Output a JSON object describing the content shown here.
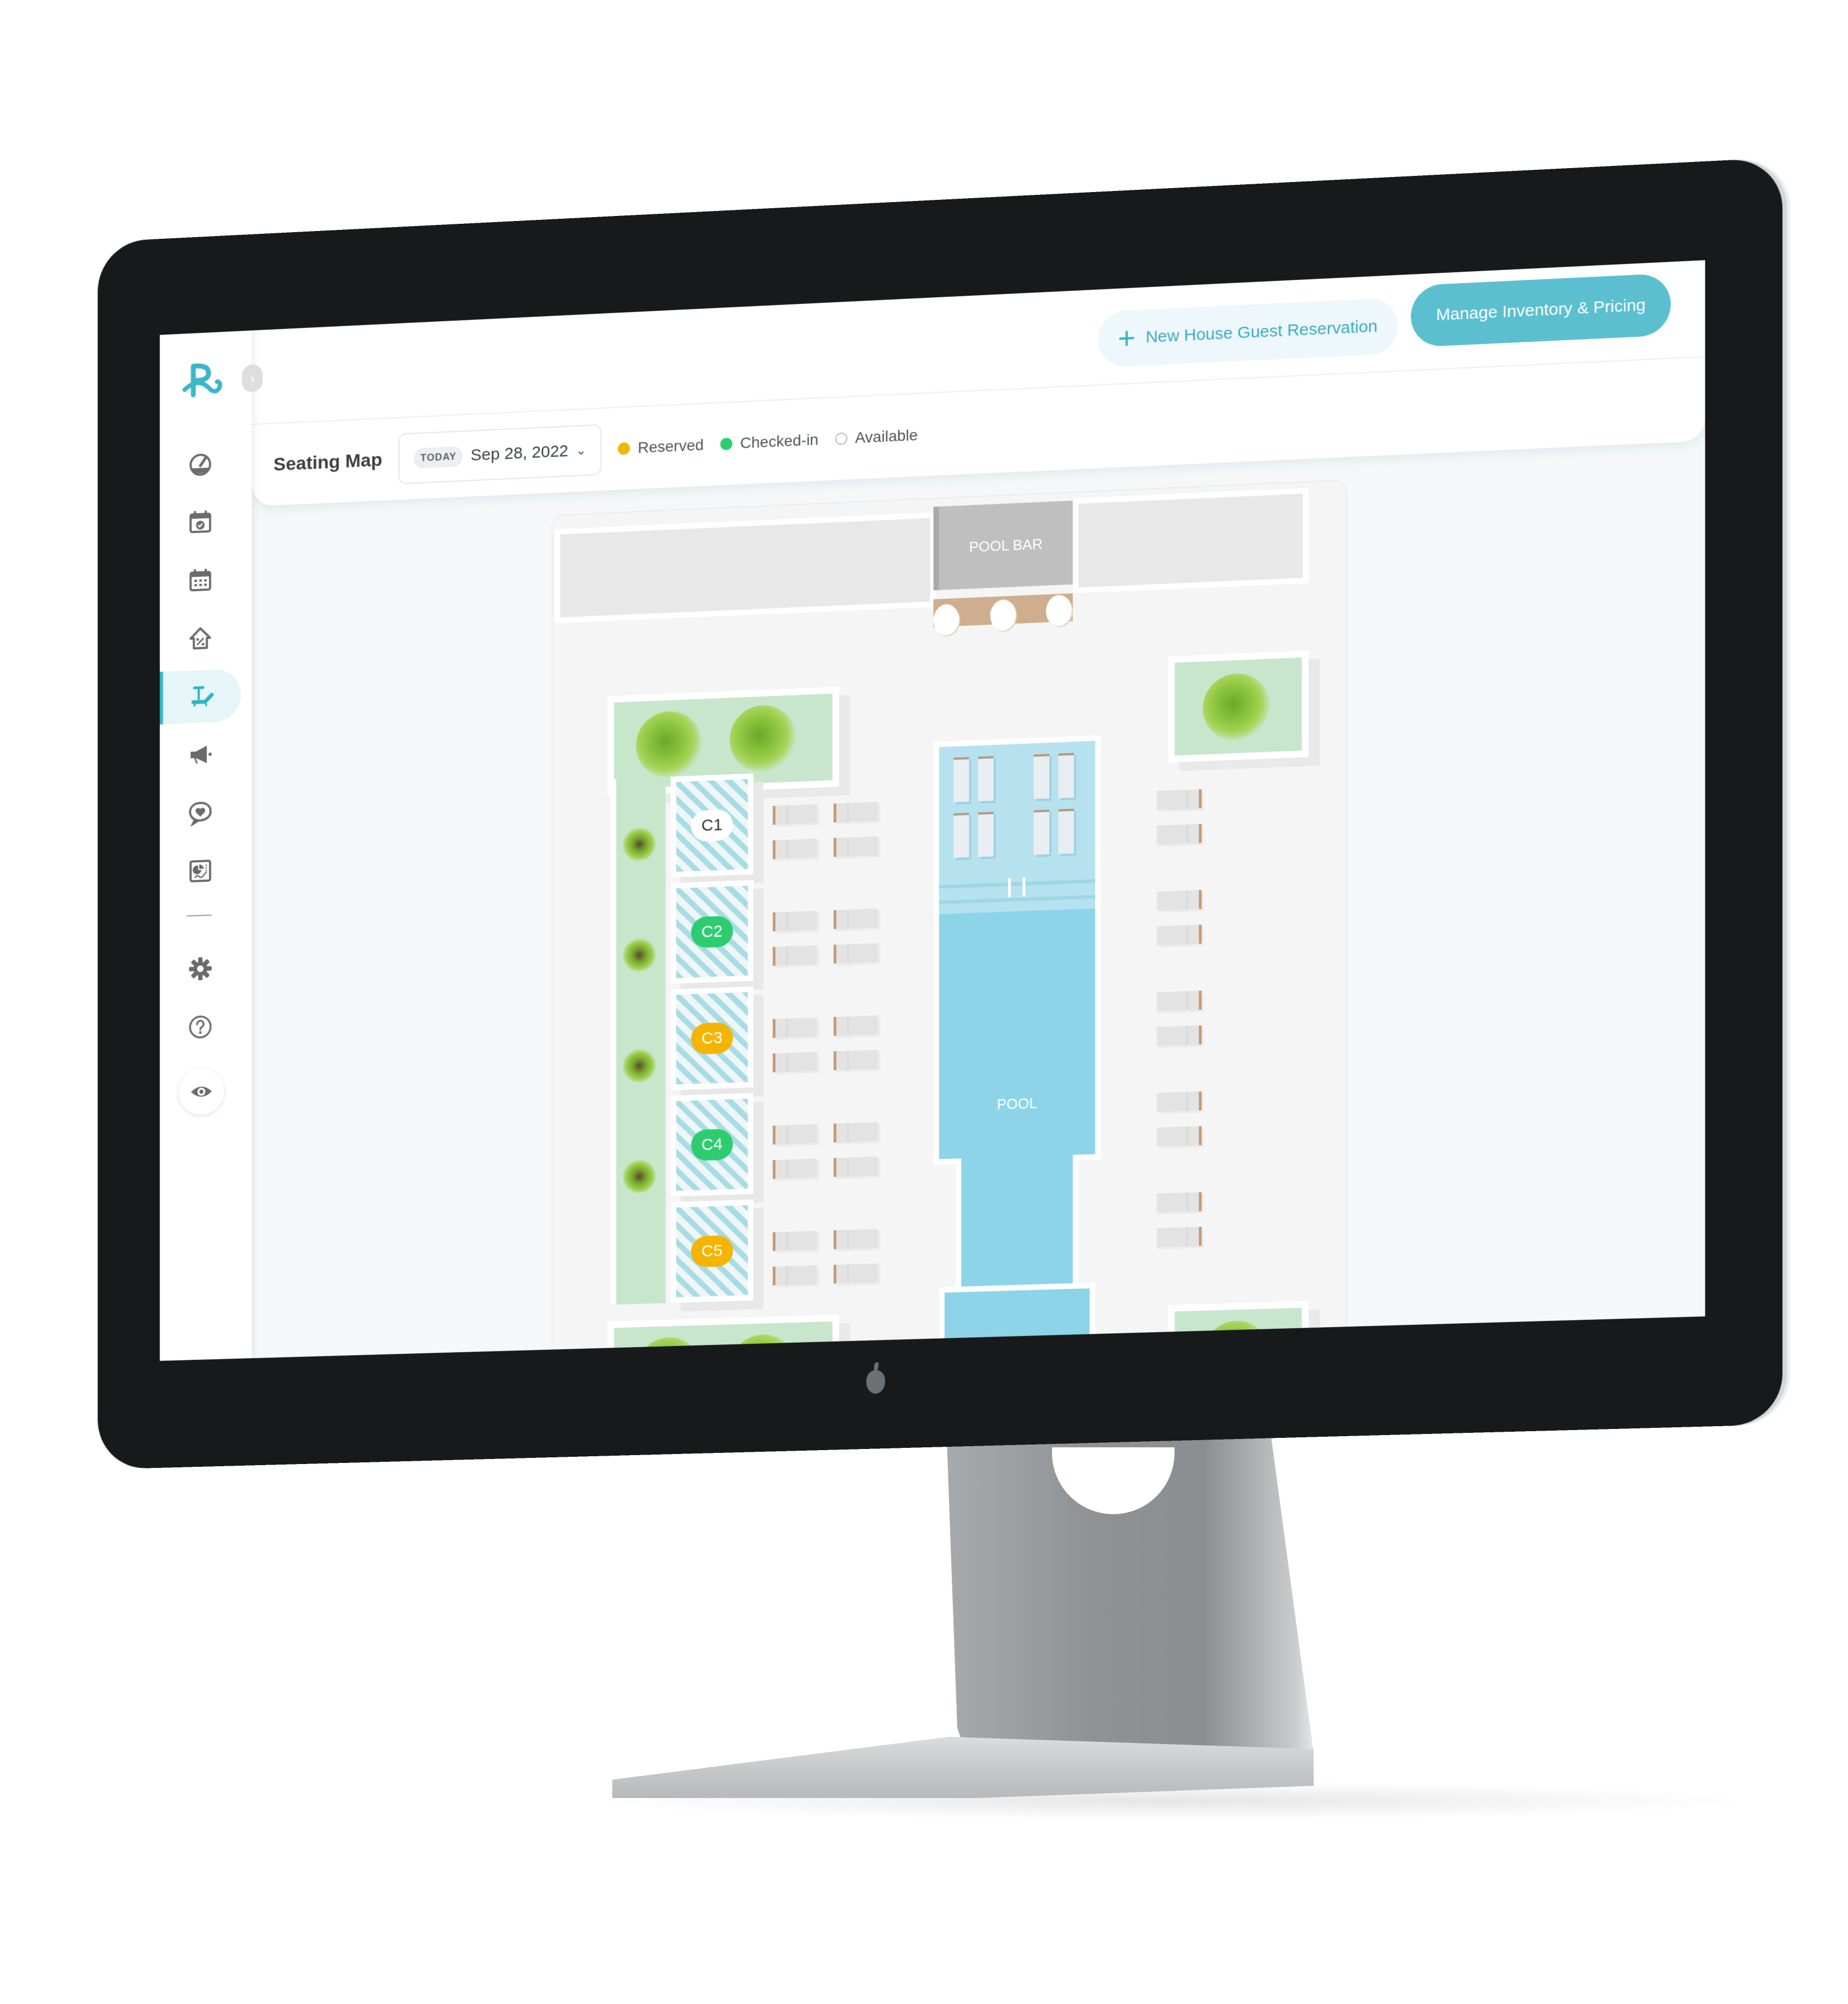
{
  "app": {
    "brand_logo": "R",
    "collapse_toggle": "›"
  },
  "header": {
    "new_reservation": {
      "icon": "plus-icon",
      "label": "New House Guest Reservation"
    },
    "manage_inventory": {
      "label": "Manage Inventory & Pricing"
    }
  },
  "toolbar": {
    "title": "Seating Map",
    "date_picker": {
      "badge": "TODAY",
      "value": "Sep 28, 2022",
      "icon": "chevron-down-icon"
    },
    "legend": [
      {
        "label": "Reserved",
        "color": "#f5b400",
        "style": "filled"
      },
      {
        "label": "Checked-in",
        "color": "#2ecc71",
        "style": "filled"
      },
      {
        "label": "Available",
        "color": "#ffffff",
        "style": "outline"
      }
    ]
  },
  "sidebar": {
    "items": [
      {
        "name": "dashboard",
        "icon": "speedometer-icon",
        "active": false
      },
      {
        "name": "reservations",
        "icon": "calendar-check-icon",
        "active": false
      },
      {
        "name": "calendar",
        "icon": "calendar-grid-icon",
        "active": false
      },
      {
        "name": "promotions",
        "icon": "house-discount-icon",
        "active": false
      },
      {
        "name": "seating-map",
        "icon": "beach-chair-icon",
        "active": true
      },
      {
        "name": "marketing",
        "icon": "megaphone-icon",
        "active": false
      },
      {
        "name": "feedback",
        "icon": "chat-heart-icon",
        "active": false
      },
      {
        "name": "reports",
        "icon": "report-chart-icon",
        "active": false
      },
      {
        "name": "settings",
        "icon": "gear-icon",
        "active": false
      },
      {
        "name": "help",
        "icon": "question-circle-icon",
        "active": false
      }
    ],
    "preview_button": {
      "icon": "eye-icon"
    }
  },
  "map": {
    "pool_bar_label": "POOL BAR",
    "pool_label": "POOL",
    "cabanas": [
      {
        "id": "C1",
        "status": "available"
      },
      {
        "id": "C2",
        "status": "checked-in"
      },
      {
        "id": "C3",
        "status": "reserved"
      },
      {
        "id": "C4",
        "status": "checked-in"
      },
      {
        "id": "C5",
        "status": "reserved"
      }
    ],
    "status_colors": {
      "available": "#ffffff",
      "checked-in": "#2ecc71",
      "reserved": "#f5b400"
    }
  },
  "colors": {
    "accent": "#3bb6c8",
    "accent_button": "#5bbfcf",
    "pool": "#8dd4e9",
    "planter": "#c8e6cc",
    "bezel": "#17191b"
  }
}
